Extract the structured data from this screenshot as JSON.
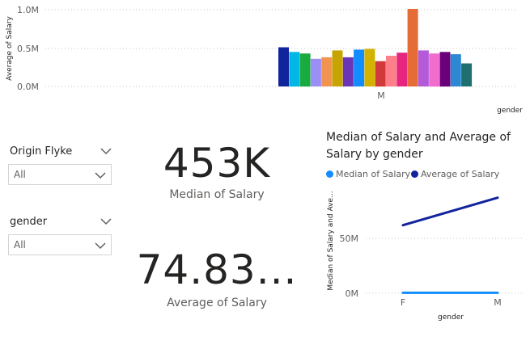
{
  "top_chart": {
    "y_axis_title": "Average of Salary",
    "y_ticks": [
      "1.0M",
      "0.5M",
      "0.0M"
    ],
    "x_category": "M",
    "x_axis_title": "gender"
  },
  "slicers": [
    {
      "title": "Origin Flyke",
      "value": "All"
    },
    {
      "title": "gender",
      "value": "All"
    }
  ],
  "cards": [
    {
      "value": "453K",
      "label": "Median of Salary"
    },
    {
      "value": "74.83...",
      "label": "Average of Salary"
    }
  ],
  "line_chart": {
    "title": "Median of Salary and Average of Salary by gender",
    "legend": [
      {
        "name": "Median of Salary",
        "color": "#118dff"
      },
      {
        "name": "Average of Salary",
        "color": "#12239e"
      }
    ],
    "y_axis_title": "Median of Salary and Ave...",
    "y_ticks": [
      "50M",
      "0M"
    ],
    "x_ticks": [
      "F",
      "M"
    ],
    "x_axis_title": "gender"
  },
  "chart_data": [
    {
      "type": "bar",
      "title": "",
      "xlabel": "gender",
      "ylabel": "Average of Salary",
      "categories": [
        "M"
      ],
      "ylim": [
        0,
        1.0
      ],
      "y_unit": "M",
      "grid": true,
      "series": [
        {
          "values": [
            0.51
          ],
          "color": "#12239e"
        },
        {
          "values": [
            0.45
          ],
          "color": "#00b7e6"
        },
        {
          "values": [
            0.43
          ],
          "color": "#1aab40"
        },
        {
          "values": [
            0.36
          ],
          "color": "#9b8ff5"
        },
        {
          "values": [
            0.38
          ],
          "color": "#f2944f"
        },
        {
          "values": [
            0.47
          ],
          "color": "#c8a400"
        },
        {
          "values": [
            0.38
          ],
          "color": "#6b35b8"
        },
        {
          "values": [
            0.48
          ],
          "color": "#118dff"
        },
        {
          "values": [
            0.49
          ],
          "color": "#d3b300"
        },
        {
          "values": [
            0.33
          ],
          "color": "#d13a3a"
        },
        {
          "values": [
            0.4
          ],
          "color": "#fd7f8a"
        },
        {
          "values": [
            0.44
          ],
          "color": "#e6257e"
        },
        {
          "values": [
            1.01
          ],
          "color": "#e66c37"
        },
        {
          "values": [
            0.47
          ],
          "color": "#b35bdb"
        },
        {
          "values": [
            0.43
          ],
          "color": "#f06dcd"
        },
        {
          "values": [
            0.45
          ],
          "color": "#6b007b"
        },
        {
          "values": [
            0.42
          ],
          "color": "#2d88d3"
        },
        {
          "values": [
            0.3
          ],
          "color": "#1f6f6f"
        }
      ]
    },
    {
      "type": "line",
      "title": "Median of Salary and Average of Salary by gender",
      "xlabel": "gender",
      "ylabel": "Median of Salary and Ave...",
      "x": [
        "F",
        "M"
      ],
      "ylim": [
        0,
        90
      ],
      "y_unit": "M",
      "series": [
        {
          "name": "Median of Salary",
          "values": [
            0.45,
            0.46
          ],
          "color": "#118dff"
        },
        {
          "name": "Average of Salary",
          "values": [
            62,
            87
          ],
          "color": "#12239e"
        }
      ]
    }
  ]
}
